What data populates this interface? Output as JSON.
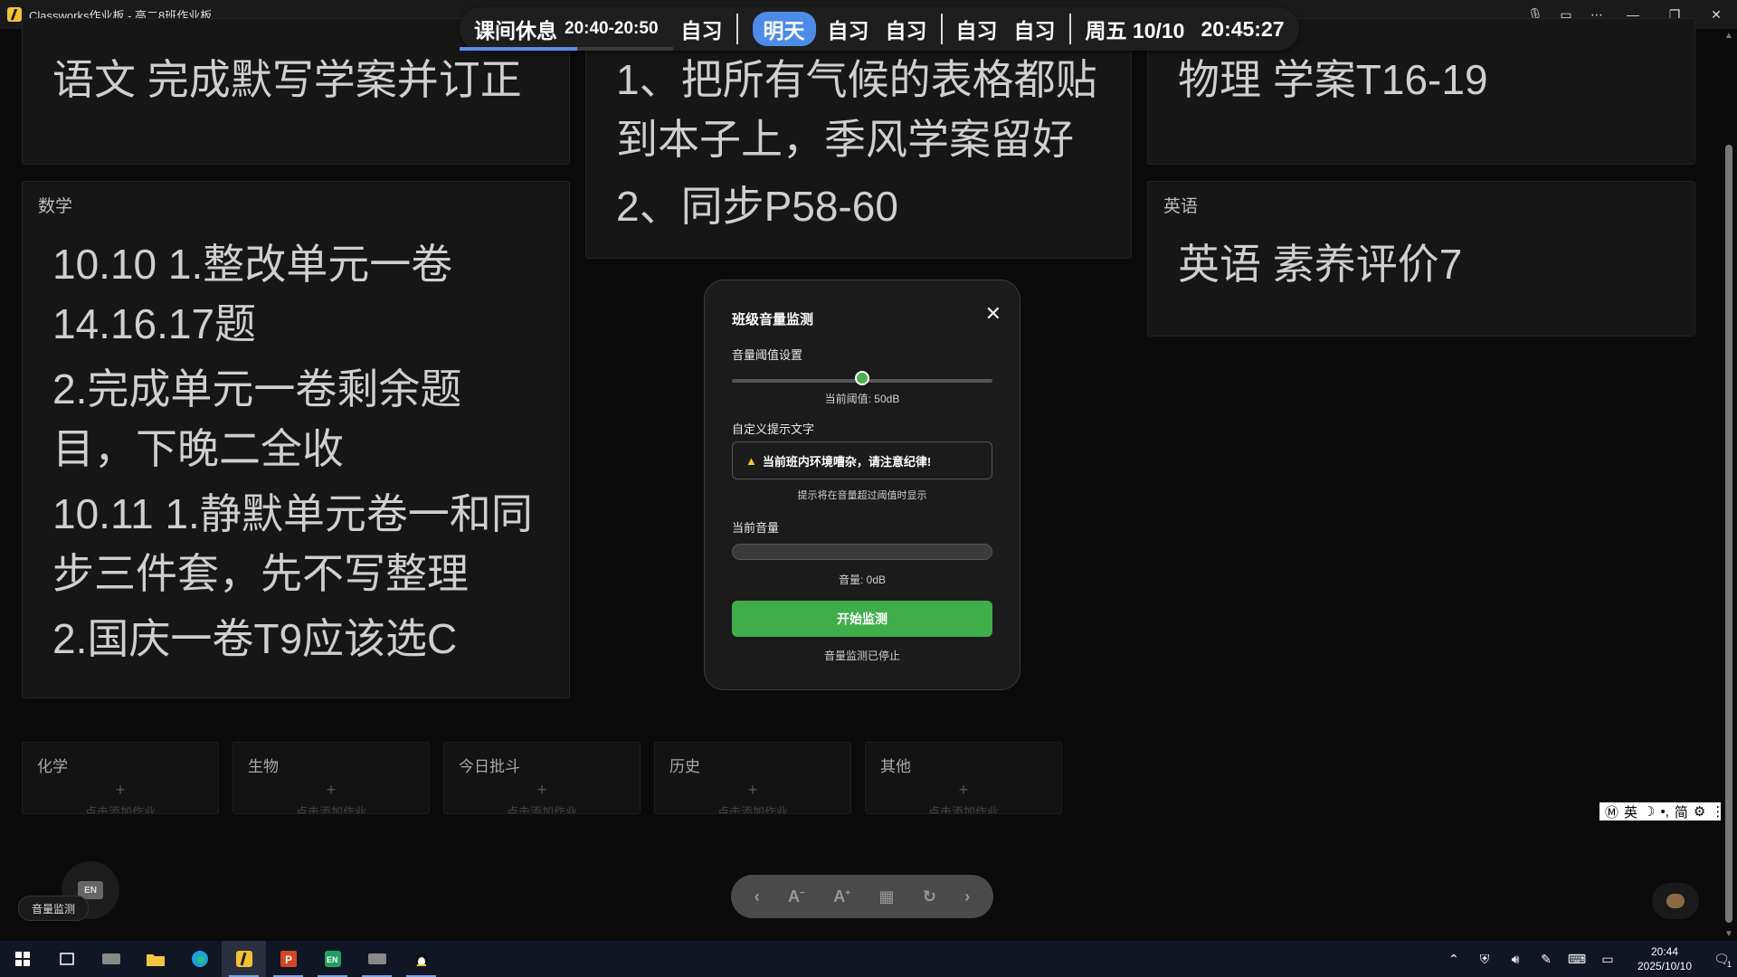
{
  "window": {
    "title": "Classworks作业板 - 高二8班作业板"
  },
  "schedule": {
    "current_label": "课间休息",
    "current_time": "20:40-20:50",
    "current_progress": 0.55,
    "today_items": [
      "自习"
    ],
    "tomorrow_badge": "明天",
    "tomorrow_items": [
      "自习",
      "自习"
    ],
    "later_items": [
      "自习",
      "自习"
    ],
    "date": "周五 10/10",
    "clock": "20:45:27"
  },
  "cards": {
    "chinese": {
      "lines": [
        "语文 完成默写学案并订正"
      ]
    },
    "geography": {
      "lines": [
        "1、把所有气候的表格都贴",
        "到本子上，季风学案留好",
        "2、同步P58-60"
      ]
    },
    "physics": {
      "lines": [
        "物理 学案T16-19"
      ]
    },
    "math": {
      "subject": "数学",
      "lines": [
        "10.10 1.整改单元一卷",
        "14.16.17题",
        "2.完成单元一卷剩余题",
        "目，下晚二全收",
        "10.11 1.静默单元卷一和同",
        "步三件套，先不写整理",
        "2.国庆一卷T9应该选C"
      ]
    },
    "english": {
      "subject": "英语",
      "lines": [
        "英语 素养评价7"
      ]
    }
  },
  "empty_cards": [
    {
      "subject": "化学",
      "plus": "+",
      "hint": "点击添加作业"
    },
    {
      "subject": "生物",
      "plus": "+",
      "hint": "点击添加作业"
    },
    {
      "subject": "今日批斗",
      "plus": "+",
      "hint": "点击添加作业"
    },
    {
      "subject": "历史",
      "plus": "+",
      "hint": "点击添加作业"
    },
    {
      "subject": "其他",
      "plus": "+",
      "hint": "点击添加作业"
    }
  ],
  "dialog": {
    "title": "班级音量监测",
    "close": "✕",
    "threshold_label": "音量阈值设置",
    "threshold_value": 50,
    "threshold_fraction": 0.5,
    "threshold_text": "当前阈值: 50dB",
    "custom_text_label": "自定义提示文字",
    "custom_text_value": "当前班内环境嘈杂，请注意纪律!",
    "custom_text_hint": "提示将在音量超过阈值时显示",
    "current_volume_label": "当前音量",
    "current_volume_fraction": 0,
    "current_volume_text": "音量: 0dB",
    "start_button": "开始监测",
    "status": "音量监测已停止"
  },
  "floating": {
    "volume_pill": "音量监测",
    "en_badge": "EN"
  },
  "ime": {
    "items": [
      "Ⓜ",
      "英",
      "☽",
      "•,",
      "简",
      "⚙",
      "⋮"
    ]
  },
  "taskbar": {
    "time": "20:44",
    "date": "2025/10/10",
    "notification_count": "1"
  },
  "colors": {
    "accent_blue": "#4d8be8",
    "green": "#3fae4a",
    "warning": "#f2c233"
  }
}
